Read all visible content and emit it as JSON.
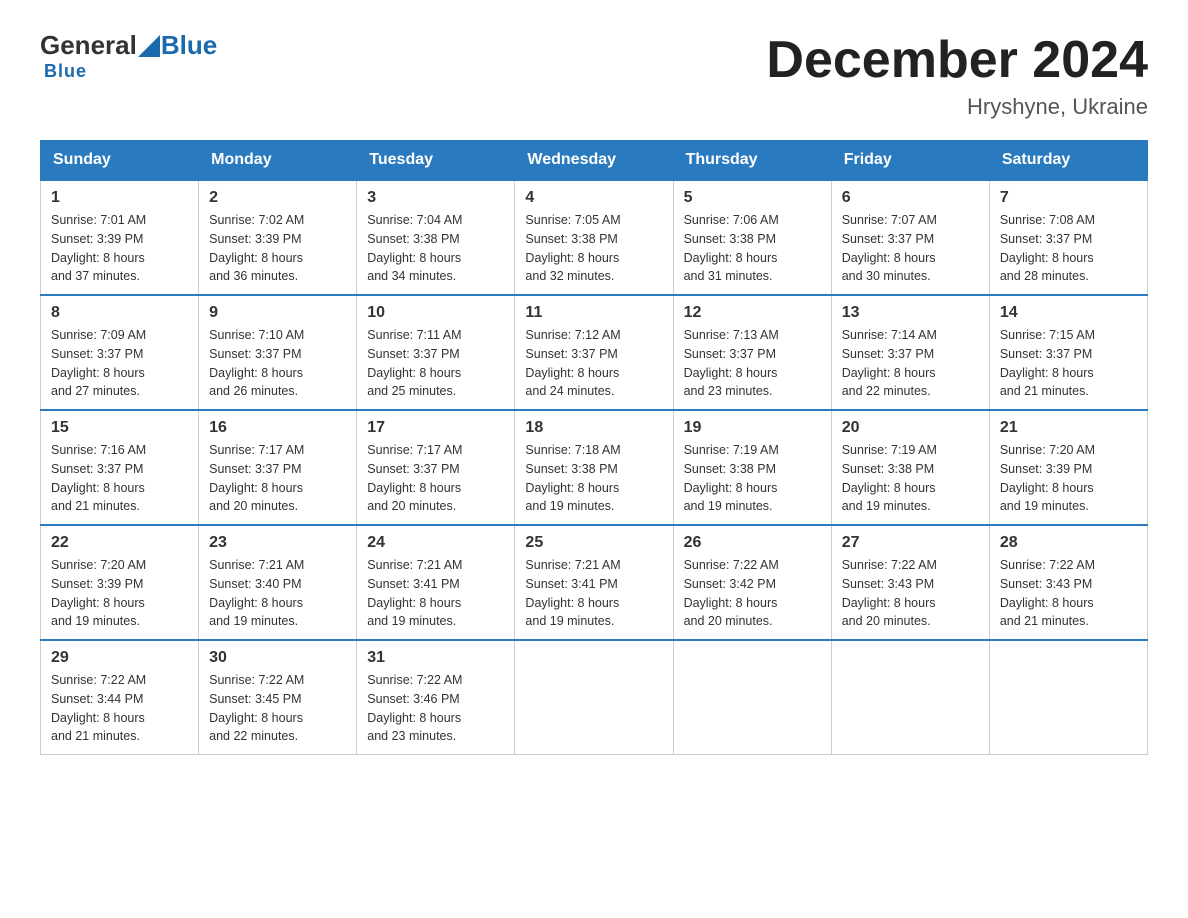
{
  "logo": {
    "general": "General",
    "blue": "Blue"
  },
  "title": "December 2024",
  "subtitle": "Hryshyne, Ukraine",
  "days_of_week": [
    "Sunday",
    "Monday",
    "Tuesday",
    "Wednesday",
    "Thursday",
    "Friday",
    "Saturday"
  ],
  "weeks": [
    [
      {
        "day": "1",
        "sunrise": "7:01 AM",
        "sunset": "3:39 PM",
        "daylight": "8 hours and 37 minutes."
      },
      {
        "day": "2",
        "sunrise": "7:02 AM",
        "sunset": "3:39 PM",
        "daylight": "8 hours and 36 minutes."
      },
      {
        "day": "3",
        "sunrise": "7:04 AM",
        "sunset": "3:38 PM",
        "daylight": "8 hours and 34 minutes."
      },
      {
        "day": "4",
        "sunrise": "7:05 AM",
        "sunset": "3:38 PM",
        "daylight": "8 hours and 32 minutes."
      },
      {
        "day": "5",
        "sunrise": "7:06 AM",
        "sunset": "3:38 PM",
        "daylight": "8 hours and 31 minutes."
      },
      {
        "day": "6",
        "sunrise": "7:07 AM",
        "sunset": "3:37 PM",
        "daylight": "8 hours and 30 minutes."
      },
      {
        "day": "7",
        "sunrise": "7:08 AM",
        "sunset": "3:37 PM",
        "daylight": "8 hours and 28 minutes."
      }
    ],
    [
      {
        "day": "8",
        "sunrise": "7:09 AM",
        "sunset": "3:37 PM",
        "daylight": "8 hours and 27 minutes."
      },
      {
        "day": "9",
        "sunrise": "7:10 AM",
        "sunset": "3:37 PM",
        "daylight": "8 hours and 26 minutes."
      },
      {
        "day": "10",
        "sunrise": "7:11 AM",
        "sunset": "3:37 PM",
        "daylight": "8 hours and 25 minutes."
      },
      {
        "day": "11",
        "sunrise": "7:12 AM",
        "sunset": "3:37 PM",
        "daylight": "8 hours and 24 minutes."
      },
      {
        "day": "12",
        "sunrise": "7:13 AM",
        "sunset": "3:37 PM",
        "daylight": "8 hours and 23 minutes."
      },
      {
        "day": "13",
        "sunrise": "7:14 AM",
        "sunset": "3:37 PM",
        "daylight": "8 hours and 22 minutes."
      },
      {
        "day": "14",
        "sunrise": "7:15 AM",
        "sunset": "3:37 PM",
        "daylight": "8 hours and 21 minutes."
      }
    ],
    [
      {
        "day": "15",
        "sunrise": "7:16 AM",
        "sunset": "3:37 PM",
        "daylight": "8 hours and 21 minutes."
      },
      {
        "day": "16",
        "sunrise": "7:17 AM",
        "sunset": "3:37 PM",
        "daylight": "8 hours and 20 minutes."
      },
      {
        "day": "17",
        "sunrise": "7:17 AM",
        "sunset": "3:37 PM",
        "daylight": "8 hours and 20 minutes."
      },
      {
        "day": "18",
        "sunrise": "7:18 AM",
        "sunset": "3:38 PM",
        "daylight": "8 hours and 19 minutes."
      },
      {
        "day": "19",
        "sunrise": "7:19 AM",
        "sunset": "3:38 PM",
        "daylight": "8 hours and 19 minutes."
      },
      {
        "day": "20",
        "sunrise": "7:19 AM",
        "sunset": "3:38 PM",
        "daylight": "8 hours and 19 minutes."
      },
      {
        "day": "21",
        "sunrise": "7:20 AM",
        "sunset": "3:39 PM",
        "daylight": "8 hours and 19 minutes."
      }
    ],
    [
      {
        "day": "22",
        "sunrise": "7:20 AM",
        "sunset": "3:39 PM",
        "daylight": "8 hours and 19 minutes."
      },
      {
        "day": "23",
        "sunrise": "7:21 AM",
        "sunset": "3:40 PM",
        "daylight": "8 hours and 19 minutes."
      },
      {
        "day": "24",
        "sunrise": "7:21 AM",
        "sunset": "3:41 PM",
        "daylight": "8 hours and 19 minutes."
      },
      {
        "day": "25",
        "sunrise": "7:21 AM",
        "sunset": "3:41 PM",
        "daylight": "8 hours and 19 minutes."
      },
      {
        "day": "26",
        "sunrise": "7:22 AM",
        "sunset": "3:42 PM",
        "daylight": "8 hours and 20 minutes."
      },
      {
        "day": "27",
        "sunrise": "7:22 AM",
        "sunset": "3:43 PM",
        "daylight": "8 hours and 20 minutes."
      },
      {
        "day": "28",
        "sunrise": "7:22 AM",
        "sunset": "3:43 PM",
        "daylight": "8 hours and 21 minutes."
      }
    ],
    [
      {
        "day": "29",
        "sunrise": "7:22 AM",
        "sunset": "3:44 PM",
        "daylight": "8 hours and 21 minutes."
      },
      {
        "day": "30",
        "sunrise": "7:22 AM",
        "sunset": "3:45 PM",
        "daylight": "8 hours and 22 minutes."
      },
      {
        "day": "31",
        "sunrise": "7:22 AM",
        "sunset": "3:46 PM",
        "daylight": "8 hours and 23 minutes."
      },
      null,
      null,
      null,
      null
    ]
  ],
  "labels": {
    "sunrise": "Sunrise:",
    "sunset": "Sunset:",
    "daylight": "Daylight:"
  }
}
